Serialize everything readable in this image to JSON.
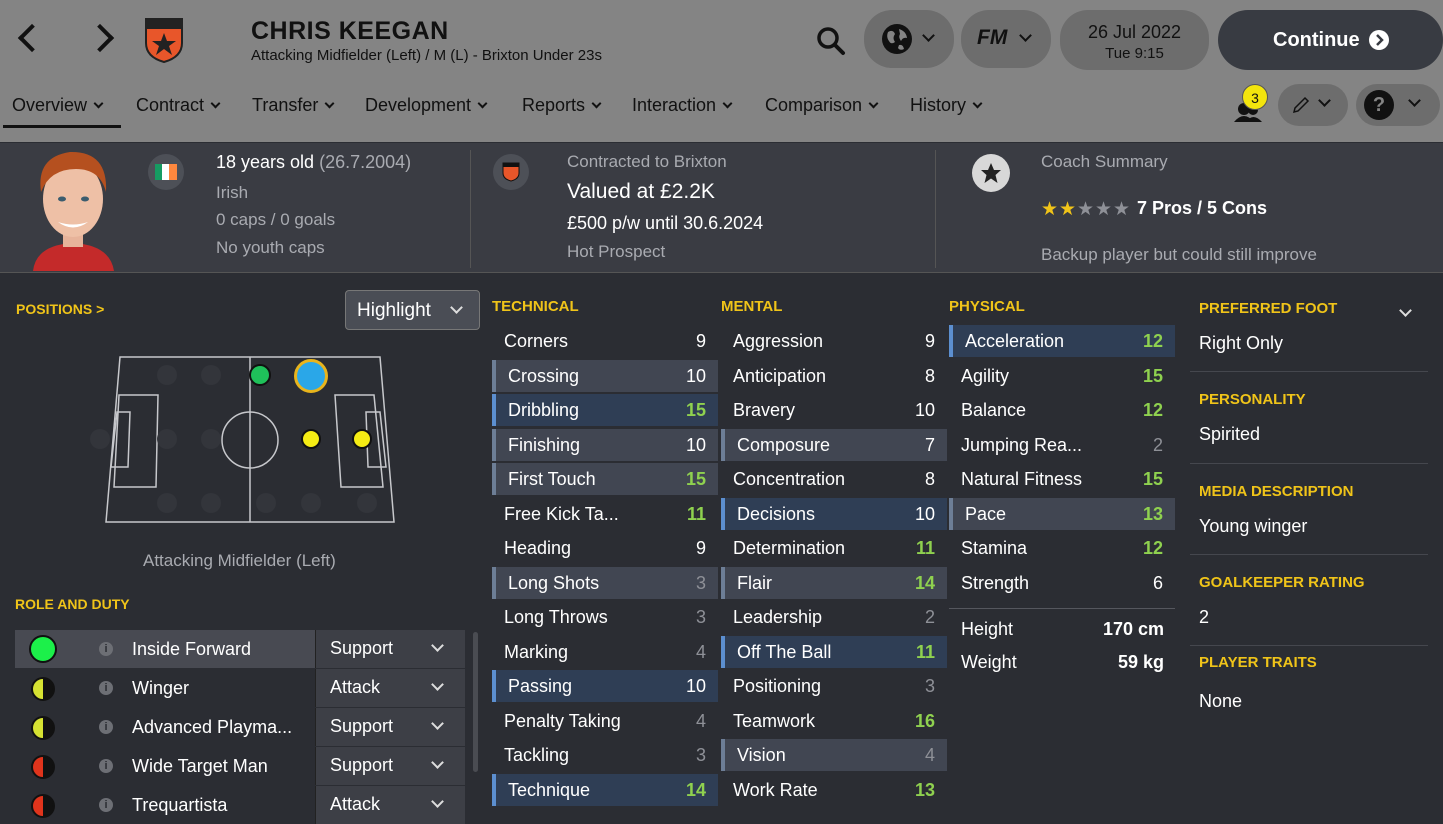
{
  "top": {
    "player_name": "CHRIS KEEGAN",
    "subtitle": "Attacking Midfielder (Left) / M (L) - Brixton Under 23s",
    "date": "26 Jul 2022",
    "time": "Tue 9:15",
    "continue_label": "Continue",
    "fm_label": "FM",
    "badge_count": "3"
  },
  "tabs": [
    "Overview",
    "Contract",
    "Transfer",
    "Development",
    "Reports",
    "Interaction",
    "Comparison",
    "History"
  ],
  "header": {
    "age": "18 years old",
    "dob": "(26.7.2004)",
    "nationality": "Irish",
    "caps": "0 caps / 0 goals",
    "youth_caps": "No youth caps",
    "contracted": "Contracted to Brixton",
    "value": "Valued at £2.2K",
    "wage": "£500 p/w until 30.6.2024",
    "status": "Hot Prospect",
    "coach_title": "Coach Summary",
    "stars": 2,
    "pros_cons": "7 Pros / 5 Cons",
    "coach_note": "Backup player but could still improve"
  },
  "positions": {
    "title": "POSITIONS >",
    "highlight": "Highlight",
    "caption": "Attacking Midfielder (Left)"
  },
  "role": {
    "title": "ROLE AND DUTY",
    "rows": [
      {
        "name": "Inside Forward",
        "duty": "Support",
        "circle": "green"
      },
      {
        "name": "Winger",
        "duty": "Attack",
        "circle": "half-yellow"
      },
      {
        "name": "Advanced Playma...",
        "duty": "Support",
        "circle": "half-yellow"
      },
      {
        "name": "Wide Target Man",
        "duty": "Support",
        "circle": "half-red"
      },
      {
        "name": "Trequartista",
        "duty": "Attack",
        "circle": "half-red"
      }
    ]
  },
  "technical": {
    "title": "TECHNICAL",
    "attrs": [
      {
        "name": "Corners",
        "value": "9"
      },
      {
        "name": "Crossing",
        "value": "10"
      },
      {
        "name": "Dribbling",
        "value": "15"
      },
      {
        "name": "Finishing",
        "value": "10"
      },
      {
        "name": "First Touch",
        "value": "15"
      },
      {
        "name": "Free Kick Ta...",
        "value": "11"
      },
      {
        "name": "Heading",
        "value": "9"
      },
      {
        "name": "Long Shots",
        "value": "3"
      },
      {
        "name": "Long Throws",
        "value": "3"
      },
      {
        "name": "Marking",
        "value": "4"
      },
      {
        "name": "Passing",
        "value": "10"
      },
      {
        "name": "Penalty Taking",
        "value": "4"
      },
      {
        "name": "Tackling",
        "value": "3"
      },
      {
        "name": "Technique",
        "value": "14"
      }
    ]
  },
  "mental": {
    "title": "MENTAL",
    "attrs": [
      {
        "name": "Aggression",
        "value": "9"
      },
      {
        "name": "Anticipation",
        "value": "8"
      },
      {
        "name": "Bravery",
        "value": "10"
      },
      {
        "name": "Composure",
        "value": "7"
      },
      {
        "name": "Concentration",
        "value": "8"
      },
      {
        "name": "Decisions",
        "value": "10"
      },
      {
        "name": "Determination",
        "value": "11"
      },
      {
        "name": "Flair",
        "value": "14"
      },
      {
        "name": "Leadership",
        "value": "2"
      },
      {
        "name": "Off The Ball",
        "value": "11"
      },
      {
        "name": "Positioning",
        "value": "3"
      },
      {
        "name": "Teamwork",
        "value": "16"
      },
      {
        "name": "Vision",
        "value": "4"
      },
      {
        "name": "Work Rate",
        "value": "13"
      }
    ]
  },
  "physical": {
    "title": "PHYSICAL",
    "attrs": [
      {
        "name": "Acceleration",
        "value": "12"
      },
      {
        "name": "Agility",
        "value": "15"
      },
      {
        "name": "Balance",
        "value": "12"
      },
      {
        "name": "Jumping Rea...",
        "value": "2"
      },
      {
        "name": "Natural Fitness",
        "value": "15"
      },
      {
        "name": "Pace",
        "value": "13"
      },
      {
        "name": "Stamina",
        "value": "12"
      },
      {
        "name": "Strength",
        "value": "6"
      }
    ],
    "height_label": "Height",
    "height": "170 cm",
    "weight_label": "Weight",
    "weight": "59 kg"
  },
  "info": {
    "foot_title": "PREFERRED FOOT",
    "foot": "Right Only",
    "personality_title": "PERSONALITY",
    "personality": "Spirited",
    "media_title": "MEDIA DESCRIPTION",
    "media": "Young winger",
    "gk_title": "GOALKEEPER RATING",
    "gk": "2",
    "traits_title": "PLAYER TRAITS",
    "traits": "None"
  },
  "colors": {
    "accent": "#f0c419",
    "green_value": "#8fd14f",
    "top_bar": "#848484",
    "panel": "#2b2d33"
  }
}
